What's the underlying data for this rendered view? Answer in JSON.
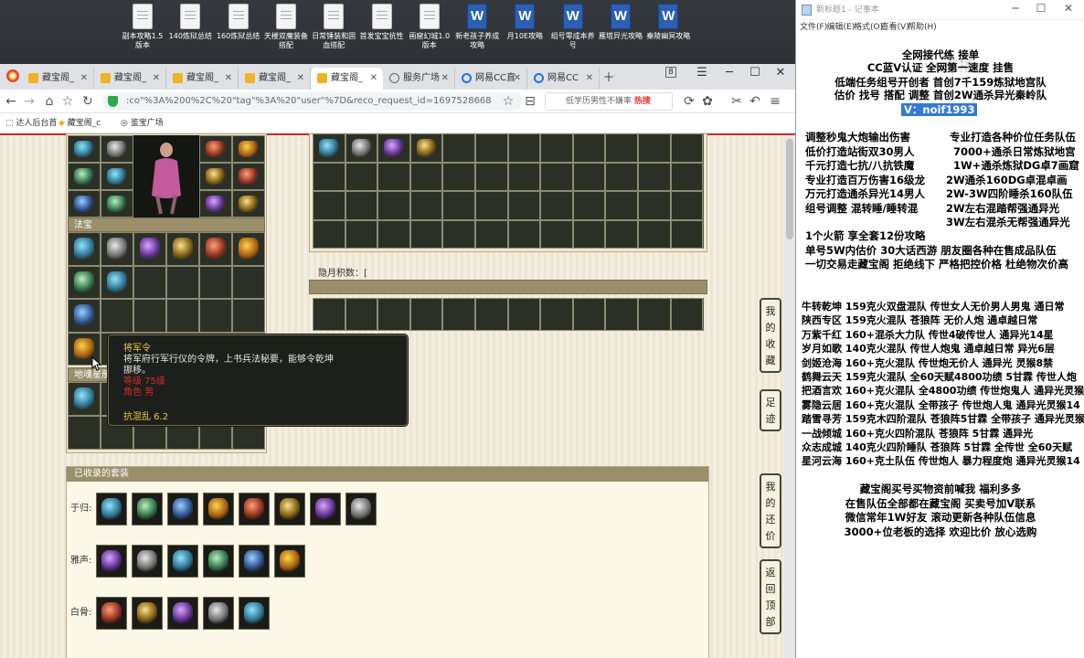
{
  "desktop": {
    "icons": [
      {
        "label": "副本攻略1.5版本",
        "type": "doc"
      },
      {
        "label": "140炼狱总结",
        "type": "doc"
      },
      {
        "label": "160炼狱总结",
        "type": "doc"
      },
      {
        "label": "天楼双魔装备搭配",
        "type": "doc"
      },
      {
        "label": "日常锤装和固血搭配",
        "type": "doc"
      },
      {
        "label": "首发宝宝抗性",
        "type": "doc"
      },
      {
        "label": "画窟幻城1.0版本",
        "type": "doc"
      },
      {
        "label": "新老孩子养成攻略",
        "type": "word"
      },
      {
        "label": "月10E攻略",
        "type": "word"
      },
      {
        "label": "组号零成本养号",
        "type": "word"
      },
      {
        "label": "雁塔异光攻略",
        "type": "word"
      },
      {
        "label": "秦陵幽冥攻略",
        "type": "word"
      }
    ]
  },
  "browser": {
    "tabs": [
      {
        "label": "藏宝阁_",
        "icon": "treasure-icon"
      },
      {
        "label": "藏宝阁_",
        "icon": "treasure-icon"
      },
      {
        "label": "藏宝阁_",
        "icon": "treasure-icon"
      },
      {
        "label": "藏宝阁_",
        "icon": "treasure-icon"
      },
      {
        "label": "藏宝阁_",
        "icon": "treasure-icon",
        "active": true
      },
      {
        "label": "服务广场",
        "icon": "globe-icon"
      },
      {
        "label": "网易CC直",
        "icon": "cc-icon"
      },
      {
        "label": "网易CC",
        "icon": "cc-icon"
      }
    ],
    "tab_count_badge": "8",
    "url": ":co\"%3A%200%2C%20\"tag\"%3A%20\"user\"%7D&reco_request_id=1697528668921sKOTq",
    "search_text": "低学历男性不嫌率",
    "search_hot": "热搜",
    "bookmarks": [
      "达人后台首",
      "藏宝阁_c",
      "鉴宝广场"
    ]
  },
  "game": {
    "section_fabao": "法宝",
    "section_dihun": "地魂星册",
    "pet_text": "隐月积数：[",
    "tooltip": {
      "name": "将军令",
      "desc": "将军府行军行仪的令牌，上书兵法秘要，能够令乾坤挪移。",
      "req1": "等级  75级",
      "req2": "角色  男",
      "stat": "抗混乱 6.2"
    },
    "collected_title": "已收录的套装",
    "sets": [
      {
        "label": "于归:",
        "count": 8
      },
      {
        "label": "雅声:",
        "count": 6
      },
      {
        "label": "白骨:",
        "count": 5
      }
    ],
    "side_buttons": [
      {
        "chars": [
          "我",
          "的",
          "收",
          "藏"
        ]
      },
      {
        "chars": [
          "足",
          "迹"
        ]
      },
      {
        "chars": [
          "我",
          "的",
          "还",
          "价"
        ]
      },
      {
        "chars": [
          "返",
          "回",
          "顶",
          "部"
        ]
      }
    ]
  },
  "notepad": {
    "title": "新标题1 - 记事本",
    "menu": [
      "文件(F)",
      "编辑(E)",
      "格式(O)",
      "查看(V)",
      "帮助(H)"
    ],
    "watermark": "ovo直播",
    "header": [
      "全网接代练 接单",
      "CC蓝V认证 全网第一速度 挂售",
      "低端任务组号开创者          首创7千159炼狱地宫队",
      "估价 找号 搭配 调整          首创2W通杀异光秦岭队"
    ],
    "highlight": "V：noif1993",
    "services": [
      [
        "调整秒鬼大炮输出伤害",
        "专业打造各种价位任务队伍"
      ],
      [
        "低价打造站街双30男人",
        "7000+通杀日常炼狱地宫"
      ],
      [
        "千元打造七抗/八抗铁魔",
        "1W+通杀炼狱DG卓7画窟"
      ],
      [
        "专业打造百万伤害16级龙",
        "2W通杀160DG卓混卓画"
      ],
      [
        "万元打造通杀异光14男人",
        "2W-3W四阶睡杀160队伍"
      ],
      [
        "组号调整 混转睡/睡转混",
        "2W左右混踏帮强通异光"
      ],
      [
        "",
        "3W左右混杀无帮强通异光"
      ]
    ],
    "extras": [
      "1个火箭 享全套12份攻略",
      "单号5W内估价 30大话西游          朋友圈各种在售成品队伍",
      "一切交易走藏宝阁 拒绝线下      严格把控价格 杜绝物次价高"
    ],
    "listings": [
      "牛转乾坤 159克火双盘混队 传世女人无价男人男鬼 通日常",
      "陕西专区 159克火混队 苍狼阵 无价人炮 通卓越日常",
      "万紫千红 160+混杀大力队 传世4破传世人 通异光14星",
      "岁月如歌 140克火混队 传世人炮鬼 通卓越日常 异光6层",
      "剑姬沧海 160+克火混队 传世炮无价人 通异光 灵猴8禁",
      "鹤舞云天 159克火混队 全60天赋4800功绩 5甘霖 传世人炮",
      "把酒言欢 160+克火混队 全4800功绩 传世炮鬼人 通异光灵猴",
      "雾隐云居 160+克火混队 全带孩子 传世炮人鬼 通异光灵猴14",
      "踏雪寻芳 159克木四阶混队 苍狼阵5甘霖 全带孩子 通异光灵猴",
      "一战倾城 160+克火四阶混队 苍狼阵 5甘霖 通异光",
      "众志成城 140克火四阶睡队 苍狼阵 5甘霖 全传世 全60天赋",
      "星河云海 160+克土队伍 传世炮人 暴力程度炮 通异光灵猴14"
    ],
    "footer": [
      "藏宝阁买号买物资前喊我 福利多多",
      "在售队伍全部都在藏宝阁 买卖号加V联系",
      "微信常年1W好友 滚动更新各种队伍信息",
      "3000+位老板的选择 欢迎比价 放心选购"
    ]
  }
}
